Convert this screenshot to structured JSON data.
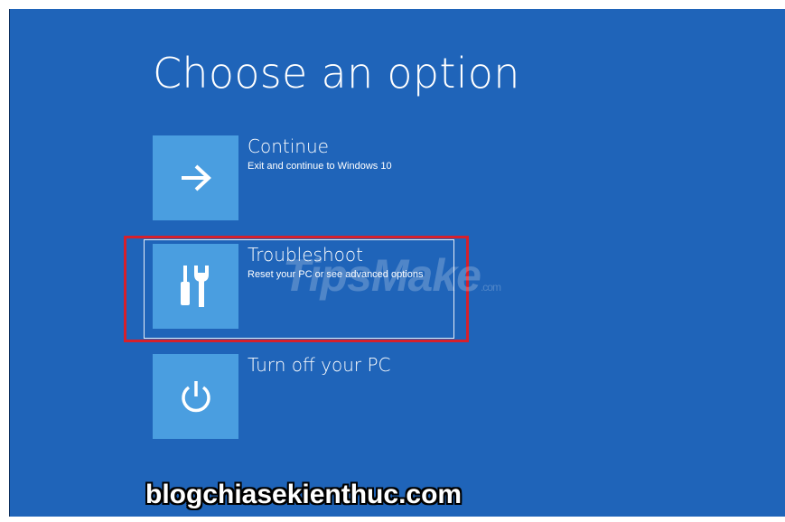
{
  "page": {
    "title": "Choose an option"
  },
  "options": [
    {
      "id": "continue",
      "title": "Continue",
      "description": "Exit and continue to Windows 10",
      "icon": "arrow-right-icon"
    },
    {
      "id": "troubleshoot",
      "title": "Troubleshoot",
      "description": "Reset your PC or see advanced options",
      "icon": "tools-icon"
    },
    {
      "id": "turnoff",
      "title": "Turn off your PC",
      "description": "",
      "icon": "power-icon"
    }
  ],
  "watermark": {
    "text": "TipsMake",
    "suffix": ".com"
  },
  "footer": {
    "banner": "blogchiasekienthuc.com"
  },
  "colors": {
    "background": "#1f64b9",
    "tile": "#4a9ee0",
    "text": "#ffffff",
    "highlight": "#d6202c"
  }
}
